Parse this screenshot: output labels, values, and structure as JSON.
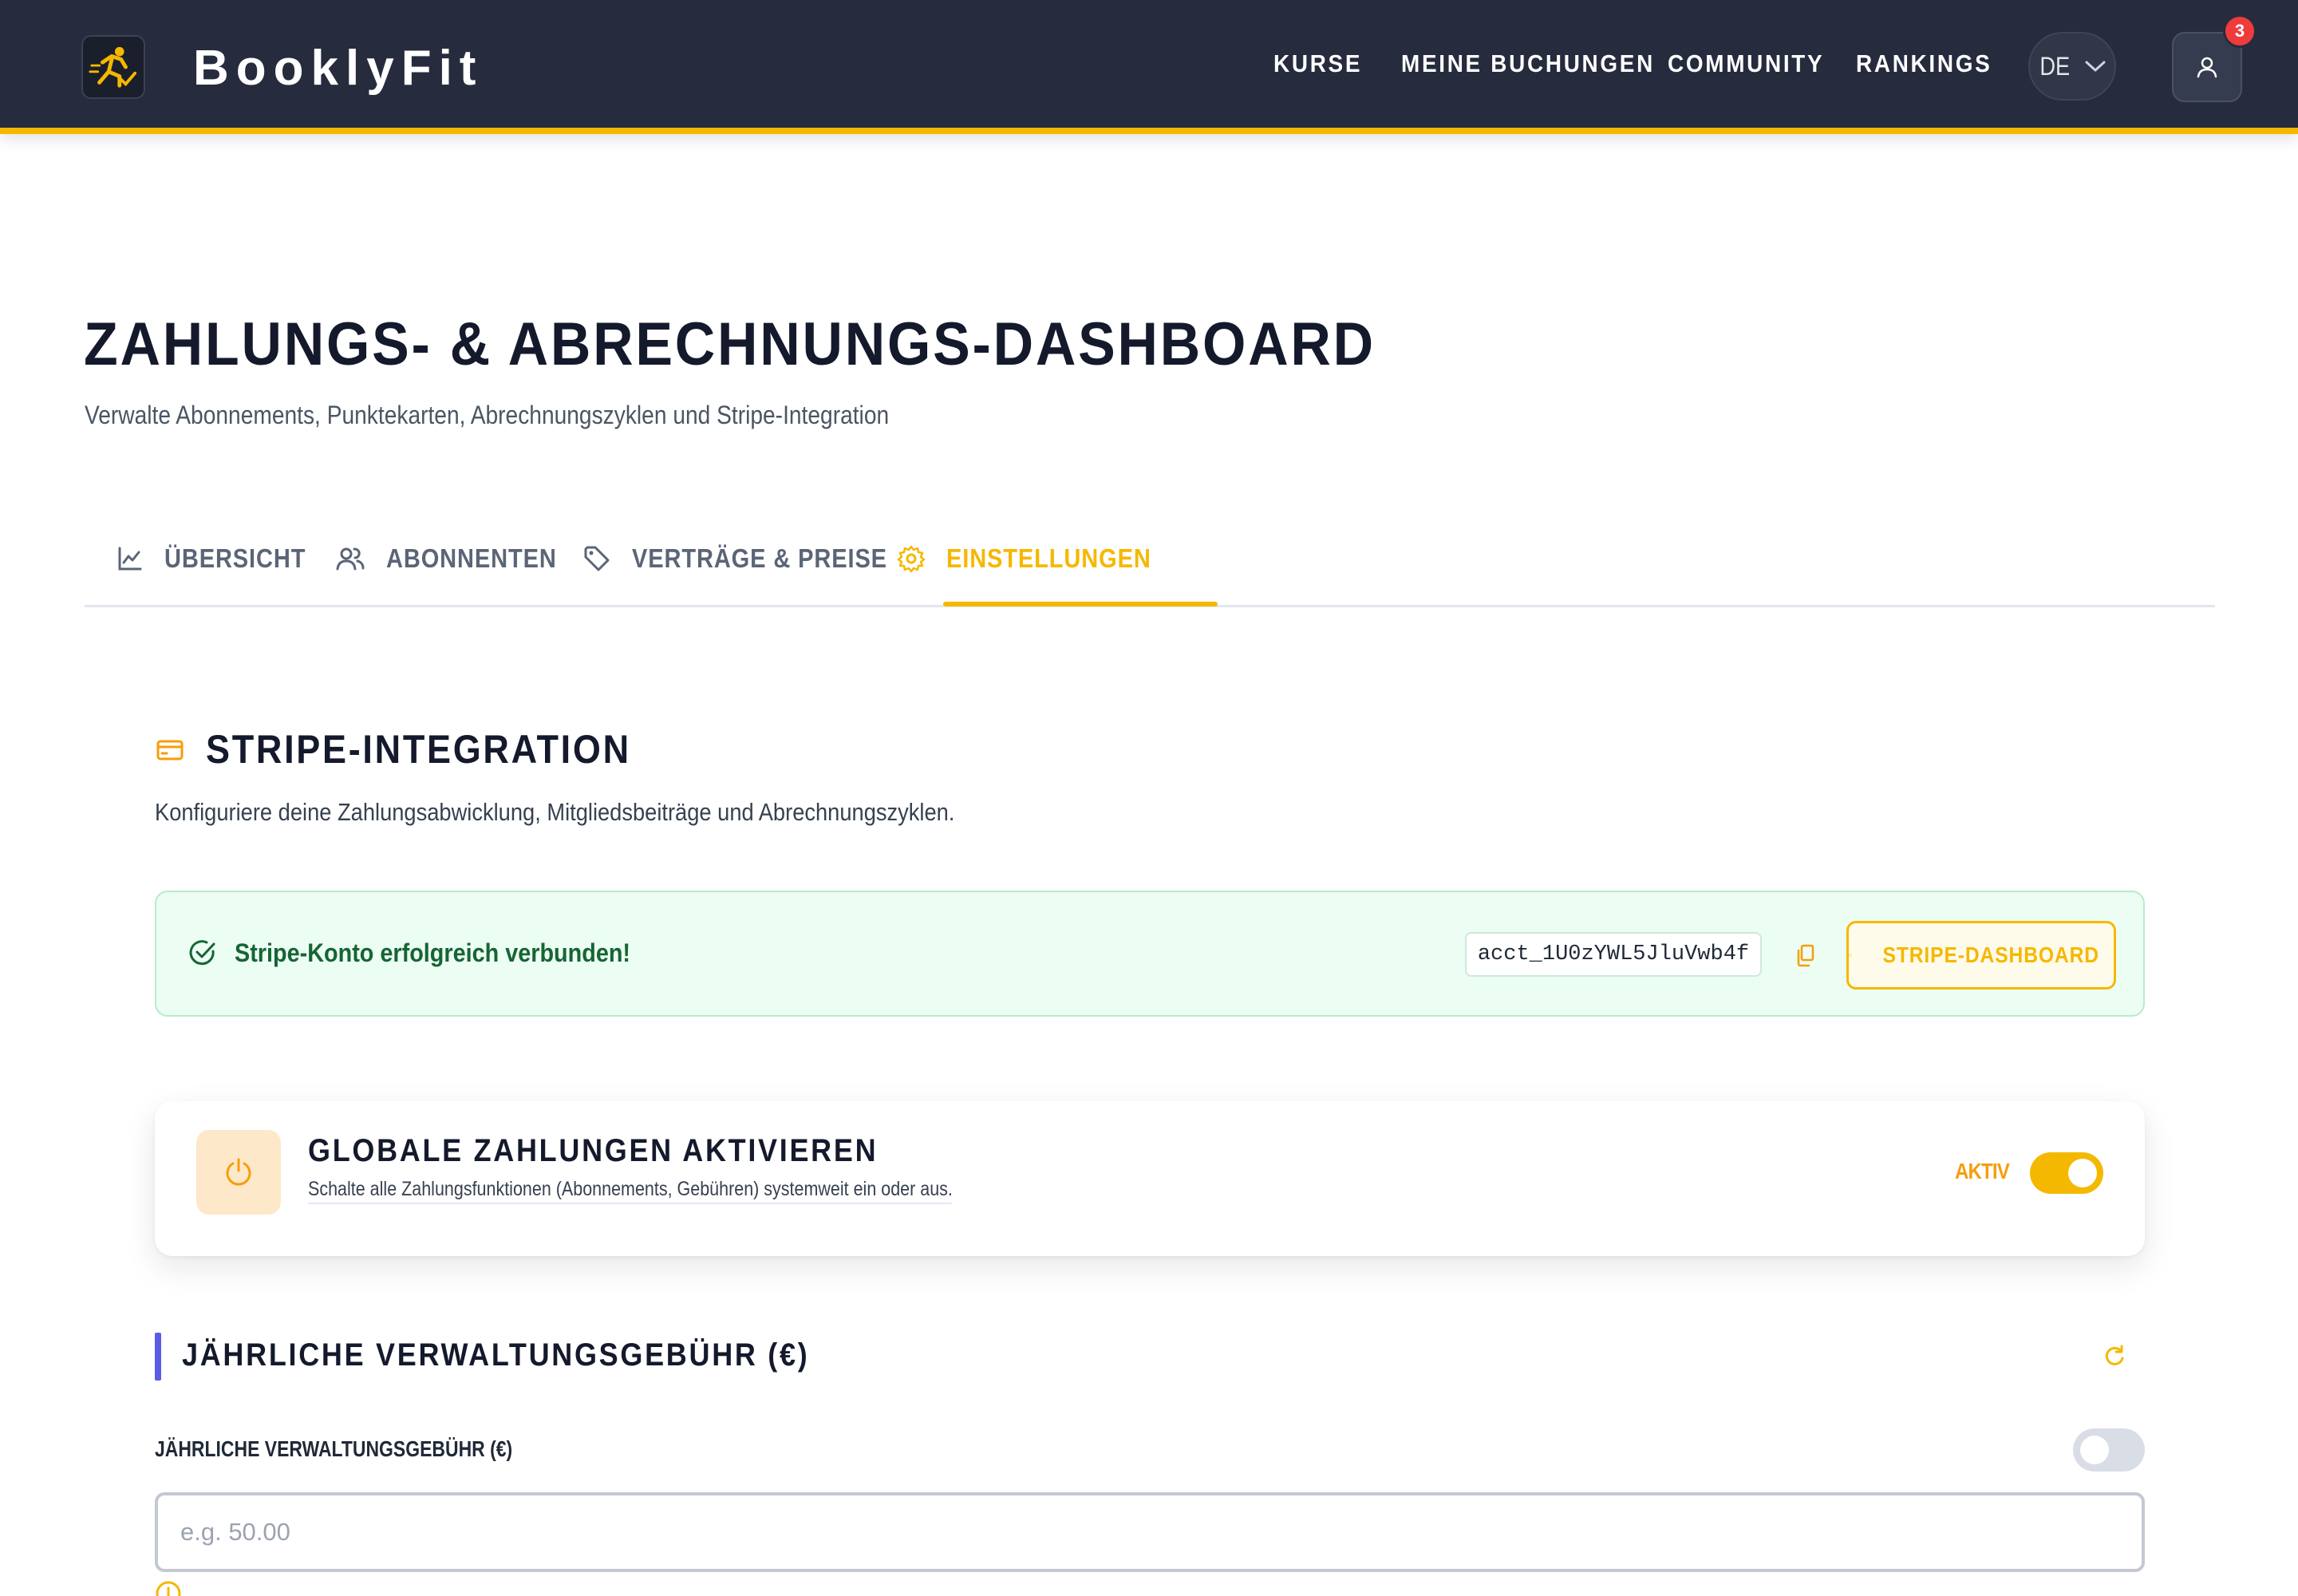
{
  "app": {
    "brand": "BooklyFit",
    "nav": [
      "KURSE",
      "MEINE BUCHUNGEN",
      "COMMUNITY",
      "RANKINGS"
    ],
    "language": "DE",
    "notification_count": "3",
    "icons": {
      "logo": "runner-logo-icon",
      "user": "user-icon",
      "chevron": "chevron-down-icon"
    }
  },
  "page": {
    "title": "ZAHLUNGS- & ABRECHNUNGS-DASHBOARD",
    "subtitle": "Verwalte Abonnements, Punktekarten, Abrechnungszyklen und Stripe-Integration"
  },
  "tabs": [
    {
      "label": "ÜBERSICHT",
      "icon": "chart-line-icon",
      "active": false
    },
    {
      "label": "ABONNENTEN",
      "icon": "users-icon",
      "active": false
    },
    {
      "label": "VERTRÄGE & PREISE",
      "icon": "tag-icon",
      "active": false
    },
    {
      "label": "EINSTELLUNGEN",
      "icon": "gear-icon",
      "active": true
    }
  ],
  "stripe": {
    "title": "STRIPE-INTEGRATION",
    "description": "Konfiguriere deine Zahlungsabwicklung, Mitgliedsbeiträge und Abrechnungszyklen.",
    "status_text": "Stripe-Konto erfolgreich verbunden!",
    "account_id": "acct_1U0zYWL5JluVwb4f",
    "dashboard_button": "STRIPE-DASHBOARD"
  },
  "global_payments": {
    "title": "GLOBALE ZAHLUNGEN AKTIVIEREN",
    "description": "Schalte alle Zahlungsfunktionen (Abonnements, Gebühren) systemweit ein oder aus.",
    "status": "AKTIV",
    "enabled": true
  },
  "annual_fee": {
    "section_title": "JÄHRLICHE VERWALTUNGSGEBÜHR (€)",
    "field_label": "JÄHRLICHE VERWALTUNGSGEBÜHR (€)",
    "placeholder": "e.g. 50.00",
    "value": "",
    "enabled": false
  },
  "colors": {
    "header_bg": "#262b3d",
    "accent": "#f5b800",
    "success_bg": "#ecfdf3",
    "success_text": "#166534",
    "fee_bar": "#5b5ce6"
  }
}
